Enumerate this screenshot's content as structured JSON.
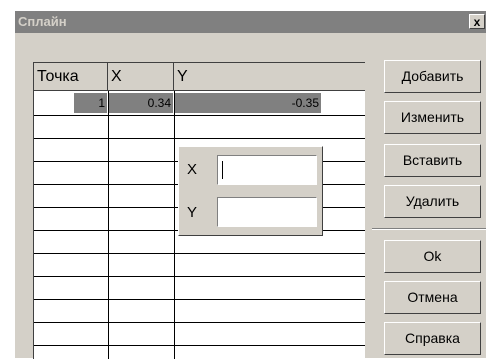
{
  "window": {
    "title": "Сплайн",
    "close_glyph": "x"
  },
  "table": {
    "columns": [
      "Точка",
      "X",
      "Y"
    ],
    "rows": [
      {
        "index": "1",
        "x": "0.34",
        "y": "-0.35"
      }
    ]
  },
  "popup": {
    "x_label": "X",
    "y_label": "Y",
    "x_value": "",
    "y_value": ""
  },
  "buttons": {
    "add": "Добавить",
    "edit": "Изменить",
    "insert": "Вставить",
    "delete": "Удалить",
    "ok": "Ok",
    "cancel": "Отмена",
    "help": "Справка"
  }
}
